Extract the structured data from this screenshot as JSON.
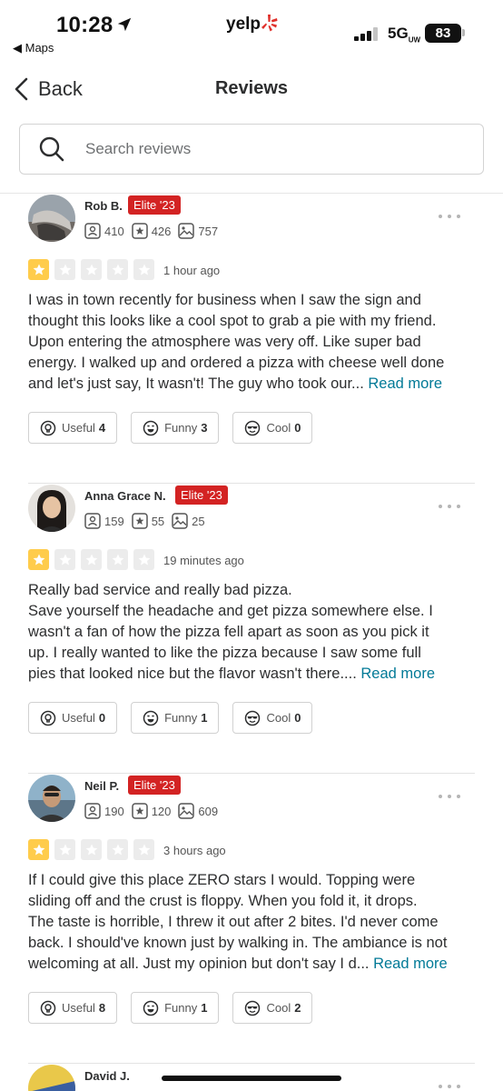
{
  "status_bar": {
    "time": "10:28",
    "back_app": "◀ Maps",
    "brand": "yelp",
    "network": "5G",
    "network_sub": "UW",
    "battery": "83"
  },
  "nav": {
    "back_label": "Back",
    "title": "Reviews"
  },
  "search": {
    "placeholder": "Search reviews",
    "value": ""
  },
  "reviews": [
    {
      "name": "Rob B.",
      "badge": "Elite '23",
      "friends": "410",
      "reviews": "426",
      "photos": "757",
      "rating": 1,
      "time": "1 hour ago",
      "text_lines": [
        "I was in town recently for business when I saw the sign and",
        "thought this looks like a cool spot to grab a pie with my friend.",
        "Upon entering the atmosphere was very off. Like super bad",
        "energy. I walked up and ordered a pizza with cheese well done",
        "and let's just say, It wasn't! The guy who took our... "
      ],
      "read_more": "Read more",
      "useful_label": "Useful",
      "useful_count": "4",
      "funny_label": "Funny",
      "funny_count": "3",
      "cool_label": "Cool",
      "cool_count": "0"
    },
    {
      "name": "Anna Grace N.",
      "badge": "Elite '23",
      "friends": "159",
      "reviews": "55",
      "photos": "25",
      "rating": 1,
      "time": "19 minutes ago",
      "text_lines": [
        "Really bad service and really bad pizza.",
        "Save yourself the headache and get pizza somewhere else. I",
        "wasn't a fan of how the pizza fell apart as soon as you pick it",
        "up. I really wanted to like the pizza because I saw some full",
        "pies that looked nice but the flavor wasn't there.... "
      ],
      "read_more": "Read more",
      "useful_label": "Useful",
      "useful_count": "0",
      "funny_label": "Funny",
      "funny_count": "1",
      "cool_label": "Cool",
      "cool_count": "0"
    },
    {
      "name": "Neil P.",
      "badge": "Elite '23",
      "friends": "190",
      "reviews": "120",
      "photos": "609",
      "rating": 1,
      "time": "3 hours ago",
      "text_lines": [
        "If I could give this place ZERO stars I would. Topping were",
        "sliding off and the crust is floppy. When you fold it, it drops.",
        "The taste is horrible, I threw it out after 2 bites. I'd never come",
        "back. I should've known just by walking in. The ambiance is not",
        "welcoming at all. Just my opinion but don't say I d... "
      ],
      "read_more": "Read more",
      "useful_label": "Useful",
      "useful_count": "8",
      "funny_label": "Funny",
      "funny_count": "1",
      "cool_label": "Cool",
      "cool_count": "2"
    },
    {
      "name": "David J."
    }
  ],
  "colors": {
    "elite": "#d32323",
    "star_on": "#ffcc4b",
    "star_off": "#ececec",
    "link": "#027a97",
    "brand_burst": "#e0302b"
  },
  "icons": [
    "location-arrow-icon",
    "yelp-burst-icon",
    "signal-icon",
    "chevron-left-icon",
    "search-icon",
    "friends-icon",
    "review-star-icon",
    "photo-icon",
    "more-dots-icon",
    "star-icon",
    "lightbulb-icon",
    "funny-face-icon",
    "cool-face-icon"
  ]
}
